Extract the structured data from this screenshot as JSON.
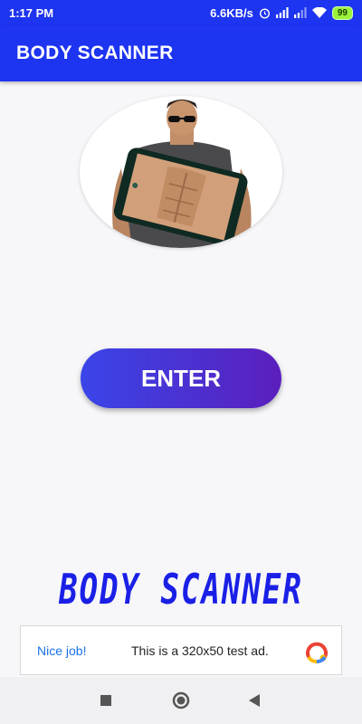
{
  "status": {
    "time": "1:17 PM",
    "network_speed": "6.6KB/s",
    "battery": "99",
    "icons": [
      "alarm-icon",
      "signal-icon",
      "signal-icon",
      "wifi-icon",
      "battery-icon"
    ]
  },
  "app_bar": {
    "title": "BODY SCANNER"
  },
  "hero": {
    "icon": "body-scan-illustration"
  },
  "main": {
    "enter_label": "ENTER"
  },
  "brand": {
    "logo_text": "BODY SCANNER"
  },
  "ad": {
    "label": "Nice job!",
    "text": "This is a 320x50 test ad.",
    "logo_icon": "adchoices-icon"
  },
  "nav": {
    "buttons": [
      "recents-button",
      "home-button",
      "back-button"
    ]
  },
  "colors": {
    "primary": "#1d34f0",
    "button_start": "#3a45e8",
    "button_end": "#5b1fbd",
    "logo": "#1a20e6",
    "ad_link": "#1a73e8"
  }
}
